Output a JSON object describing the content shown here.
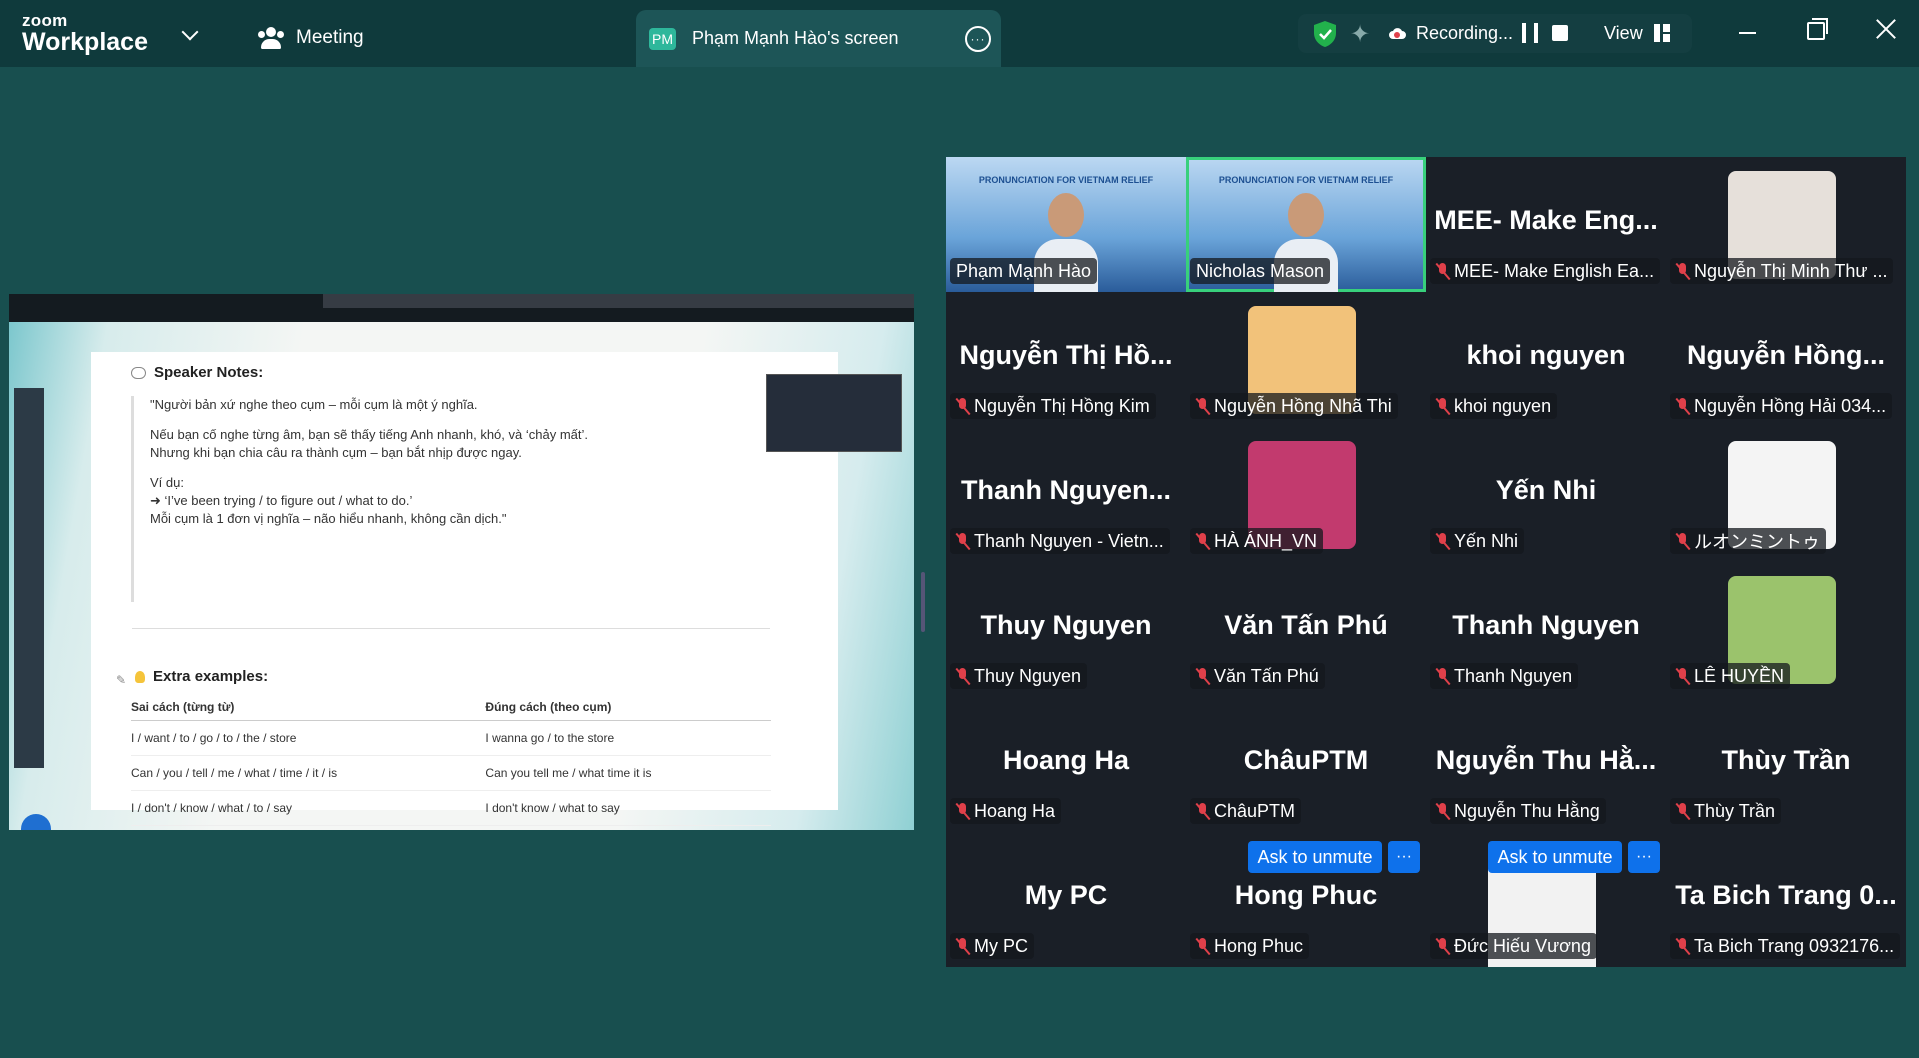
{
  "app": {
    "logo_small": "zoom",
    "logo_big": "Workplace"
  },
  "toolbar": {
    "meeting_label": "Meeting",
    "screen_badge": "PM",
    "screen_title": "Phạm Mạnh Hào's screen",
    "recording_label": "Recording...",
    "view_label": "View"
  },
  "colors": {
    "accent_green": "#2eb79b",
    "active_border": "#38d07c",
    "button_blue": "#0e71eb",
    "mic_off_red": "#e0404a"
  },
  "share": {
    "speaker_notes_title": "Speaker Notes:",
    "note_quote": "\"Người bản xứ nghe theo cụm – mỗi cụm là một ý nghĩa.",
    "note_p2_line1": "Nếu bạn cố nghe từng âm, bạn sẽ thấy tiếng Anh nhanh, khó, và ‘chảy mất’.",
    "note_p2_line2": "Nhưng khi bạn chia câu ra thành cụm – bạn bắt nhịp được ngay.",
    "note_p3_line1": "Ví dụ:",
    "note_p3_line2": "➜ ‘I’ve been trying / to figure out / what to do.’",
    "note_p3_line3": "Mỗi cụm là 1 đơn vị nghĩa – não hiểu nhanh, không cần dịch.\"",
    "extra_title": "Extra examples:",
    "col_wrong": "Sai cách (từng từ)",
    "col_right": "Đúng cách (theo cụm)",
    "rows": [
      {
        "wrong": "I / want / to / go / to / the / store",
        "right": "I wanna go / to the store"
      },
      {
        "wrong": "Can / you / tell / me / what / time / it / is",
        "right": "Can you tell me / what time it is"
      },
      {
        "wrong": "I / don't / know / what / to / say",
        "right": "I don't know / what to say"
      }
    ]
  },
  "slide_title": "PRONUNCIATION FOR VIETNAM RELIEF",
  "tiles": [
    {
      "big": "",
      "label": "Phạm Mạnh Hào"
    },
    {
      "big": "",
      "label": "Nicholas Mason"
    },
    {
      "big": "MEE- Make Eng...",
      "label": "MEE- Make English Ea..."
    },
    {
      "big": "",
      "label": "Nguyễn Thị Minh Thư ..."
    },
    {
      "big": "Nguyễn Thị Hồ...",
      "label": "Nguyễn Thị Hồng Kim"
    },
    {
      "big": "",
      "label": "Nguyễn Hồng Nhã Thi"
    },
    {
      "big": "khoi nguyen",
      "label": "khoi nguyen"
    },
    {
      "big": "Nguyễn Hồng...",
      "label": "Nguyễn Hồng Hải 034..."
    },
    {
      "big": "Thanh Nguyen...",
      "label": "Thanh Nguyen - Vietn..."
    },
    {
      "big": "",
      "label": "HÀ ÁNH_VN"
    },
    {
      "big": "Yến Nhi",
      "label": "Yến Nhi"
    },
    {
      "big": "",
      "label": "ルオンミントゥ"
    },
    {
      "big": "Thuy Nguyen",
      "label": "Thuy Nguyen"
    },
    {
      "big": "Văn Tấn Phú",
      "label": "Văn Tấn Phú"
    },
    {
      "big": "Thanh Nguyen",
      "label": "Thanh Nguyen"
    },
    {
      "big": "",
      "label": "LÊ HUYỀN"
    },
    {
      "big": "Hoang Ha",
      "label": "Hoang Ha"
    },
    {
      "big": "ChâuPTM",
      "label": "ChâuPTM"
    },
    {
      "big": "Nguyễn Thu Hằ...",
      "label": "Nguyễn Thu Hằng"
    },
    {
      "big": "Thùy Trần",
      "label": "Thùy Trần"
    },
    {
      "big": "My PC",
      "label": "My PC"
    },
    {
      "big": "Hong Phuc",
      "label": "Hong Phuc"
    },
    {
      "big": "",
      "label": "Đức Hiếu Vương"
    },
    {
      "big": "Ta Bich Trang 0...",
      "label": "Ta Bich Trang 0932176..."
    }
  ],
  "ask_to_unmute": "Ask to unmute",
  "ask_more": "···"
}
